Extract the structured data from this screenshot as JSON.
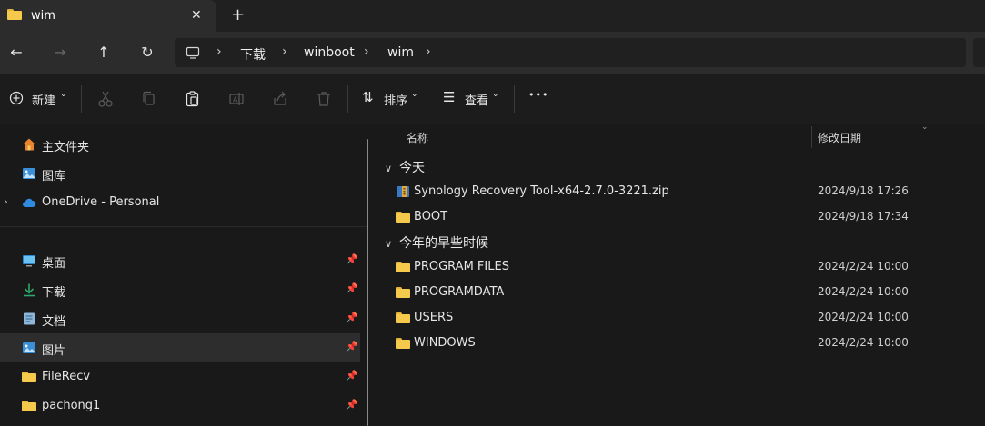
{
  "tab": {
    "title": "wim",
    "close_glyph": "✕",
    "new_glyph": "+"
  },
  "nav": {
    "back": "←",
    "forward": "→",
    "up": "↑",
    "refresh": "↻"
  },
  "breadcrumbs": [
    "下载",
    "winboot",
    "wim"
  ],
  "toolbar": {
    "new_label": "新建",
    "sort_label": "排序",
    "view_label": "查看",
    "more_label": "•••"
  },
  "sidebar": {
    "pinned_top": [
      {
        "label": "主文件夹",
        "icon": "home-icon"
      },
      {
        "label": "图库",
        "icon": "gallery-icon"
      },
      {
        "label": "OneDrive - Personal",
        "icon": "cloud-icon"
      }
    ],
    "quick_access": [
      {
        "label": "桌面",
        "icon": "desktop-icon"
      },
      {
        "label": "下载",
        "icon": "download-icon"
      },
      {
        "label": "文档",
        "icon": "document-icon"
      },
      {
        "label": "图片",
        "icon": "pictures-icon"
      },
      {
        "label": "FileRecv",
        "icon": "folder-icon"
      },
      {
        "label": "pachong1",
        "icon": "folder-icon"
      }
    ]
  },
  "columns": {
    "name": "名称",
    "modified": "修改日期"
  },
  "groups": [
    {
      "label": "今天",
      "files": [
        {
          "name": "Synology Recovery Tool-x64-2.7.0-3221.zip",
          "date": "2024/9/18 17:26",
          "icon": "zip-icon"
        },
        {
          "name": "BOOT",
          "date": "2024/9/18 17:34",
          "icon": "folder-icon"
        }
      ]
    },
    {
      "label": "今年的早些时候",
      "files": [
        {
          "name": "PROGRAM FILES",
          "date": "2024/2/24 10:00",
          "icon": "folder-icon"
        },
        {
          "name": "PROGRAMDATA",
          "date": "2024/2/24 10:00",
          "icon": "folder-icon"
        },
        {
          "name": "USERS",
          "date": "2024/2/24 10:00",
          "icon": "folder-icon"
        },
        {
          "name": "WINDOWS",
          "date": "2024/2/24 10:00",
          "icon": "folder-icon"
        }
      ]
    }
  ],
  "colors": {
    "background": "#191919",
    "folder": "#f5c94c",
    "selected": "#2d2d2d"
  }
}
